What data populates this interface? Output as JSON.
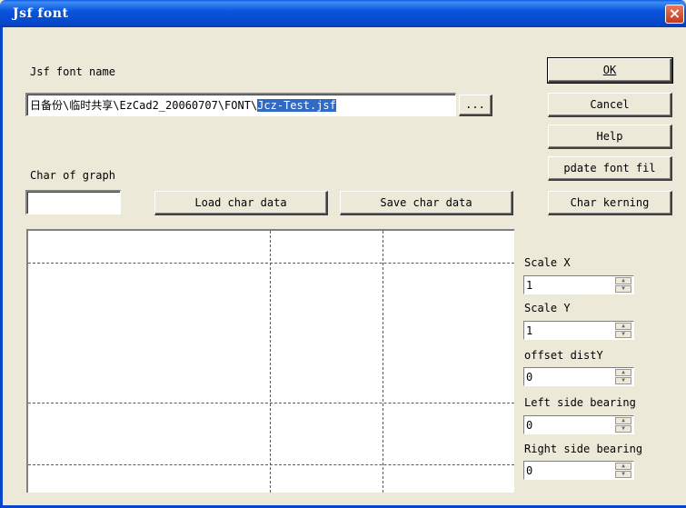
{
  "window": {
    "title": "Jsf font",
    "close_label": "×"
  },
  "font_name": {
    "label": "Jsf font name",
    "path_prefix": "日备份\\临时共享\\EzCad2_20060707\\FONT\\",
    "path_selected": "Jcz-Test.jsf",
    "browse_label": "..."
  },
  "buttons": {
    "ok": "OK",
    "cancel": "Cancel",
    "help": "Help",
    "update_font": "pdate font fil",
    "char_kerning": "Char kerning",
    "load_char": "Load char data",
    "save_char": "Save char data"
  },
  "graph": {
    "label": "Char of graph",
    "value": ""
  },
  "params": [
    {
      "label": "Scale X",
      "value": "1"
    },
    {
      "label": "Scale Y",
      "value": "1"
    },
    {
      "label": "offset distY",
      "value": "0"
    },
    {
      "label": "Left side bearing",
      "value": "0"
    },
    {
      "label": "Right side bearing",
      "value": "0"
    }
  ],
  "colors": {
    "guide_line": "#E81E1E",
    "selection": "#316AC5",
    "titlebar": "#0646C9"
  }
}
